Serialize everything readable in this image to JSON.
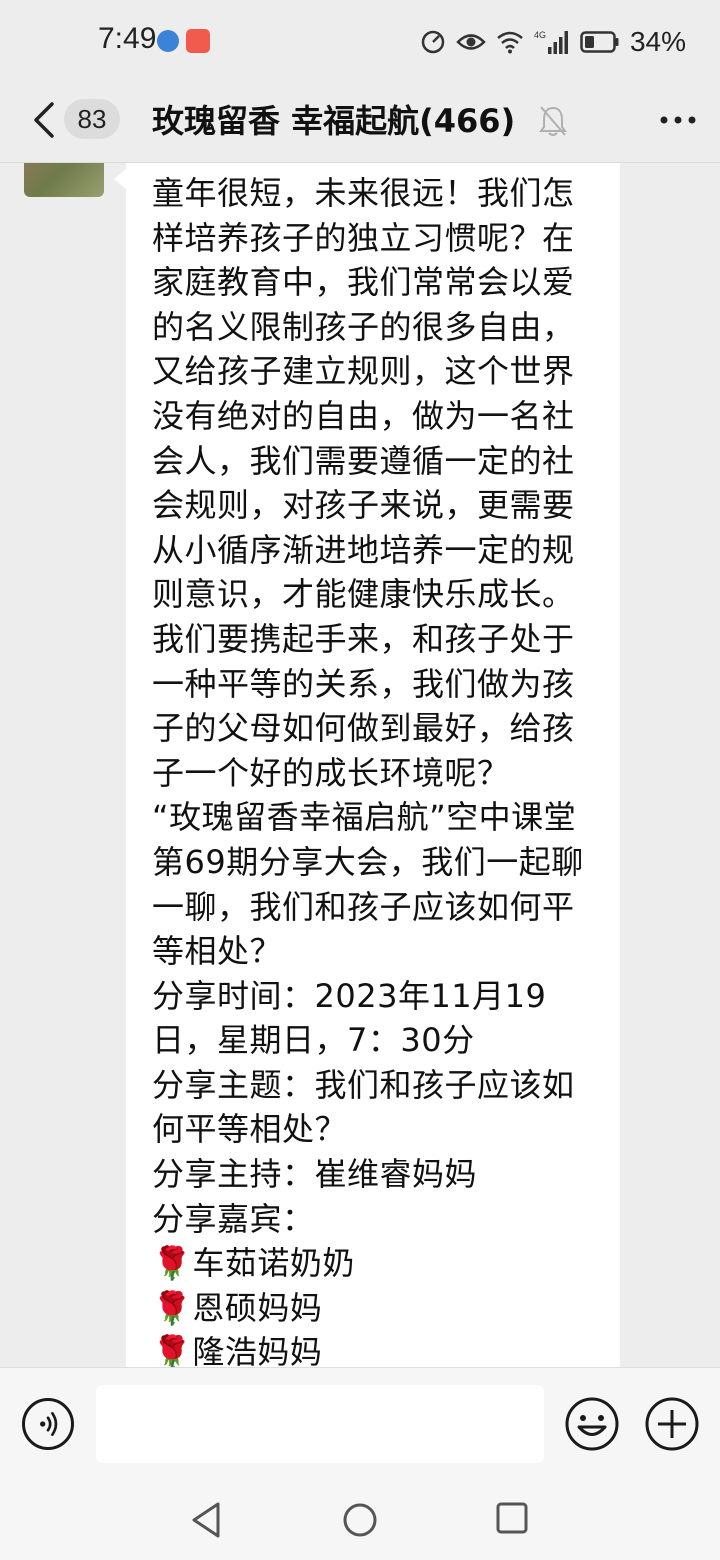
{
  "status_bar": {
    "time": "7:49",
    "battery_percent": "34%",
    "network": "4G",
    "icons": [
      "browser-app-icon",
      "video-app-icon",
      "speed-icon",
      "eye-icon",
      "wifi-icon",
      "signal-icon",
      "battery-icon"
    ]
  },
  "header": {
    "unread_count": "83",
    "title": "玫瑰留香  幸福起航(466)",
    "muted": true
  },
  "message": {
    "intro": "童年很短，未来很远！我们怎样培养孩子的独立习惯呢？在家庭教育中，我们常常会以爱的名义限制孩子的很多自由，又给孩子建立规则，这个世界没有绝对的自由，做为一名社会人，我们需要遵循一定的社会规则，对孩子来说，更需要从小循序渐进地培养一定的规则意识，才能健康快乐成长。\n我们要携起手来，和孩子处于一种平等的关系，我们做为孩子的父母如何做到最好，给孩子一个好的成长环境呢？\n“玫瑰留香幸福启航”空中课堂第69期分享大会，我们一起聊一聊，我们和孩子应该如何平等相处？\n分享时间：2023年11月19日，星期日，7：30分\n分享主题：我们和孩子应该如何平等相处？\n分享主持：崔维睿妈妈\n分享嘉宾：",
    "guests": [
      "🌹车茹诺奶奶",
      "🌹恩硕妈妈",
      "🌹隆浩妈妈"
    ]
  },
  "input": {
    "value": "",
    "placeholder": ""
  },
  "colors": {
    "background": "#ededed",
    "bubble": "#ffffff",
    "input_bar": "#f6f6f6"
  }
}
